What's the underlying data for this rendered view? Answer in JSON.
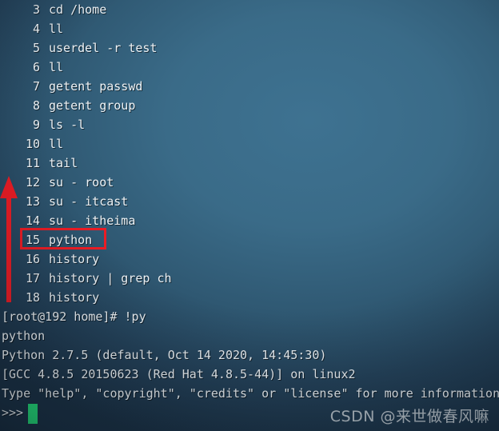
{
  "terminal": {
    "background_color": "#3a6b88",
    "text_color": "#eef3f6",
    "history": [
      {
        "num": " 3",
        "cmd": "cd /home"
      },
      {
        "num": " 4",
        "cmd": "ll"
      },
      {
        "num": " 5",
        "cmd": "userdel -r test"
      },
      {
        "num": " 6",
        "cmd": "ll"
      },
      {
        "num": " 7",
        "cmd": "getent passwd"
      },
      {
        "num": " 8",
        "cmd": "getent group"
      },
      {
        "num": " 9",
        "cmd": "ls -l"
      },
      {
        "num": "10",
        "cmd": "ll"
      },
      {
        "num": "11",
        "cmd": "tail"
      },
      {
        "num": "12",
        "cmd": "su - root"
      },
      {
        "num": "13",
        "cmd": "su - itcast"
      },
      {
        "num": "14",
        "cmd": "su - itheima"
      },
      {
        "num": "15",
        "cmd": "python"
      },
      {
        "num": "16",
        "cmd": "history"
      },
      {
        "num": "17",
        "cmd": "history | grep ch"
      },
      {
        "num": "18",
        "cmd": "history"
      }
    ],
    "output": [
      "[root@192 home]# !py",
      "python",
      "Python 2.7.5 (default, Oct 14 2020, 14:45:30)",
      "[GCC 4.8.5 20150623 (Red Hat 4.8.5-44)] on linux2",
      "Type \"help\", \"copyright\", \"credits\" or \"license\" for more information.",
      ">>> "
    ],
    "prompt_symbol": ">>>"
  },
  "annotations": {
    "highlight_color": "#ec1c24",
    "highlighted_command": "15  python",
    "arrow_color": "#ec1c24",
    "arrow_direction": "up",
    "cursor_color": "#23dd78"
  },
  "watermark": {
    "text": "CSDN @来世做春风嘛"
  }
}
